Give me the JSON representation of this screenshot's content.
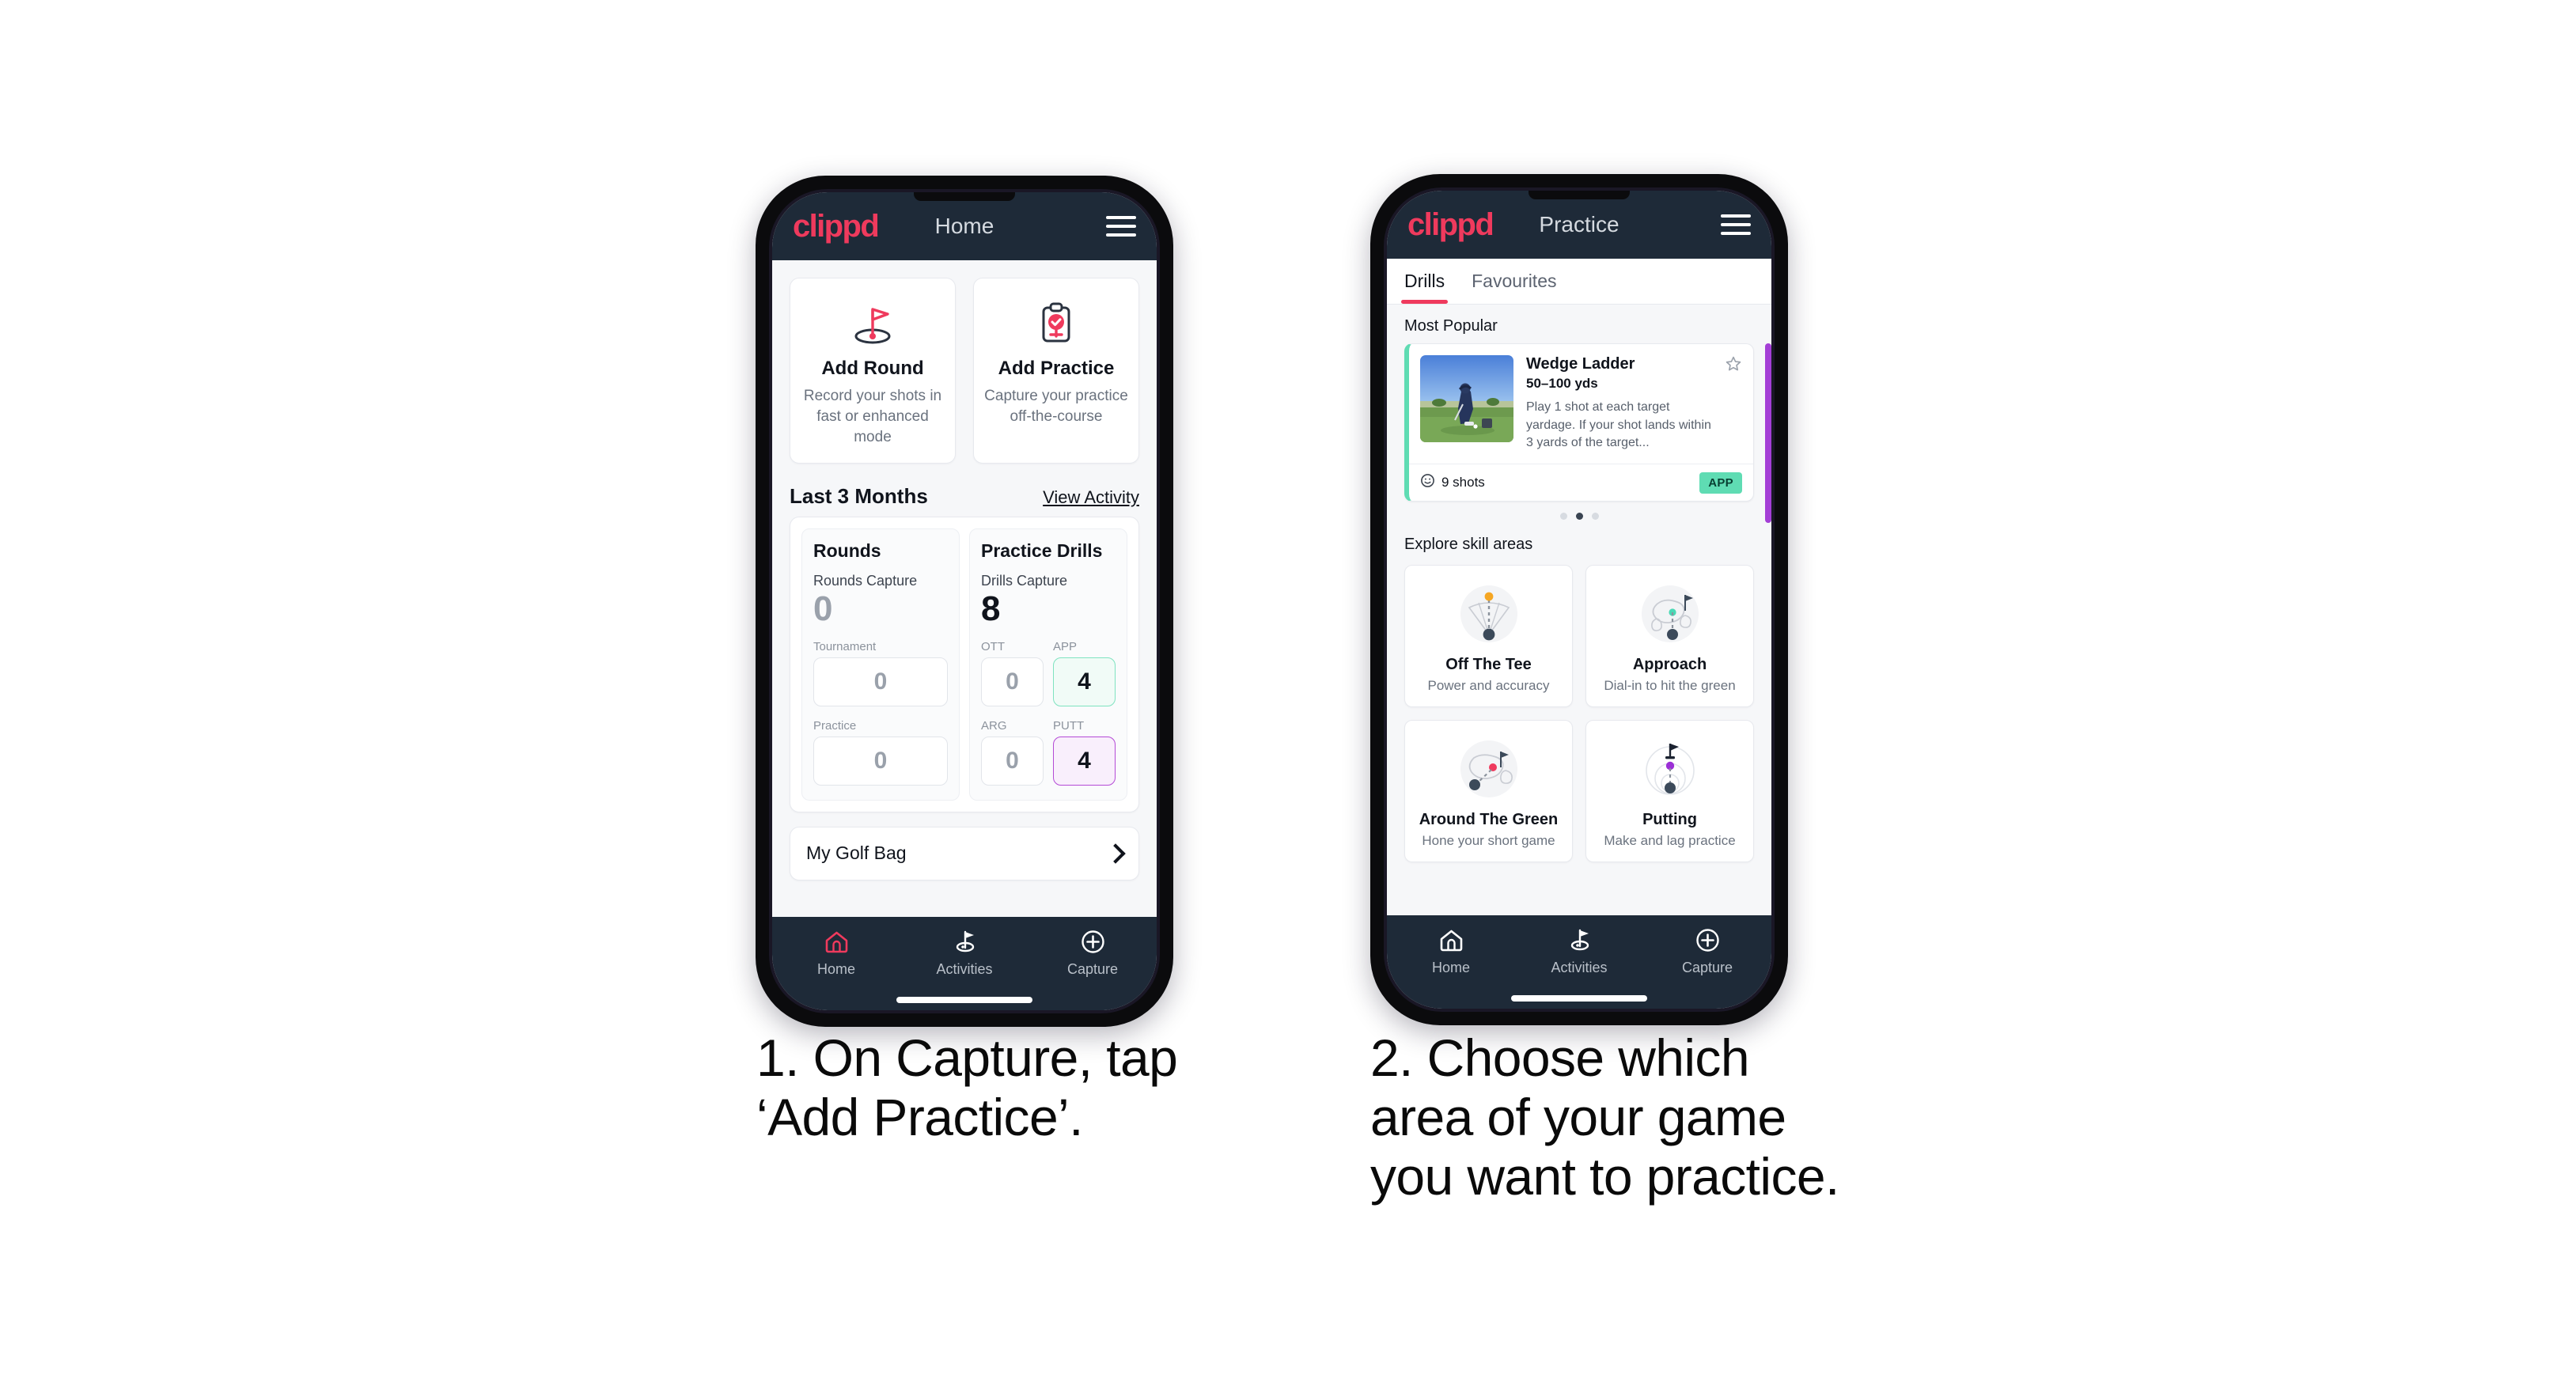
{
  "brand": {
    "name": "clippd",
    "accent": "#ef3a5d",
    "nav_bg": "#1e2a38"
  },
  "phone1": {
    "appbar": {
      "logo": "clippd",
      "title": "Home",
      "menu_icon": "hamburger-menu-icon"
    },
    "quick_actions": [
      {
        "icon": "golf-flag-icon",
        "title": "Add Round",
        "subtitle": "Record your shots in fast or enhanced mode"
      },
      {
        "icon": "clipboard-check-icon",
        "title": "Add Practice",
        "subtitle": "Capture your practice off-the-course"
      }
    ],
    "section": {
      "title": "Last 3 Months",
      "link": "View Activity"
    },
    "rounds": {
      "heading": "Rounds",
      "capture_label": "Rounds Capture",
      "capture_value": "0",
      "tiles": [
        {
          "label": "Tournament",
          "value": "0",
          "state": "zero"
        },
        {
          "label": "Practice",
          "value": "0",
          "state": "zero"
        }
      ]
    },
    "drills": {
      "heading": "Practice Drills",
      "capture_label": "Drills Capture",
      "capture_value": "8",
      "tiles": [
        {
          "label": "OTT",
          "value": "0",
          "state": "zero"
        },
        {
          "label": "APP",
          "value": "4",
          "state": "app"
        },
        {
          "label": "ARG",
          "value": "0",
          "state": "zero"
        },
        {
          "label": "PUTT",
          "value": "4",
          "state": "putt"
        }
      ]
    },
    "golf_bag": {
      "label": "My Golf Bag",
      "chevron": "chevron-right-icon"
    },
    "bottom_nav": [
      {
        "icon": "home-icon",
        "label": "Home",
        "active": true
      },
      {
        "icon": "golf-flag-icon",
        "label": "Activities",
        "active": false
      },
      {
        "icon": "plus-circle-icon",
        "label": "Capture",
        "active": false
      }
    ]
  },
  "phone2": {
    "appbar": {
      "logo": "clippd",
      "title": "Practice",
      "menu_icon": "hamburger-menu-icon"
    },
    "tabs": [
      {
        "label": "Drills",
        "active": true
      },
      {
        "label": "Favourites",
        "active": false
      }
    ],
    "most_popular_label": "Most Popular",
    "drill_card": {
      "title": "Wedge Ladder",
      "yardage": "50–100 yds",
      "description": "Play 1 shot at each target yardage. If your shot lands within 3 yards of the target...",
      "shots": "9 shots",
      "shots_icon": "clock-icon",
      "badge": "APP",
      "favourite_icon": "star-outline-icon",
      "accent": "#5fdcb3",
      "thumbnail": "golfer-chipping-photo"
    },
    "carousel": {
      "dots": 3,
      "active_index": 1
    },
    "explore_label": "Explore skill areas",
    "skills": [
      {
        "icon": "off-the-tee-icon",
        "title": "Off The Tee",
        "subtitle": "Power and accuracy",
        "dot_color": "#f5a623"
      },
      {
        "icon": "approach-icon",
        "title": "Approach",
        "subtitle": "Dial-in to hit the green",
        "dot_color": "#49d9b5"
      },
      {
        "icon": "around-the-green-icon",
        "title": "Around The Green",
        "subtitle": "Hone your short game",
        "dot_color": "#ef3a5d"
      },
      {
        "icon": "putting-icon",
        "title": "Putting",
        "subtitle": "Make and lag practice",
        "dot_color": "#9b2fd6"
      }
    ],
    "bottom_nav": [
      {
        "icon": "home-icon",
        "label": "Home",
        "active": false
      },
      {
        "icon": "golf-flag-icon",
        "label": "Activities",
        "active": true
      },
      {
        "icon": "plus-circle-icon",
        "label": "Capture",
        "active": false
      }
    ]
  },
  "captions": {
    "one": "1. On Capture, tap\n‘Add Practice’.",
    "two": "2. Choose which\narea of your game\nyou want to practice."
  }
}
